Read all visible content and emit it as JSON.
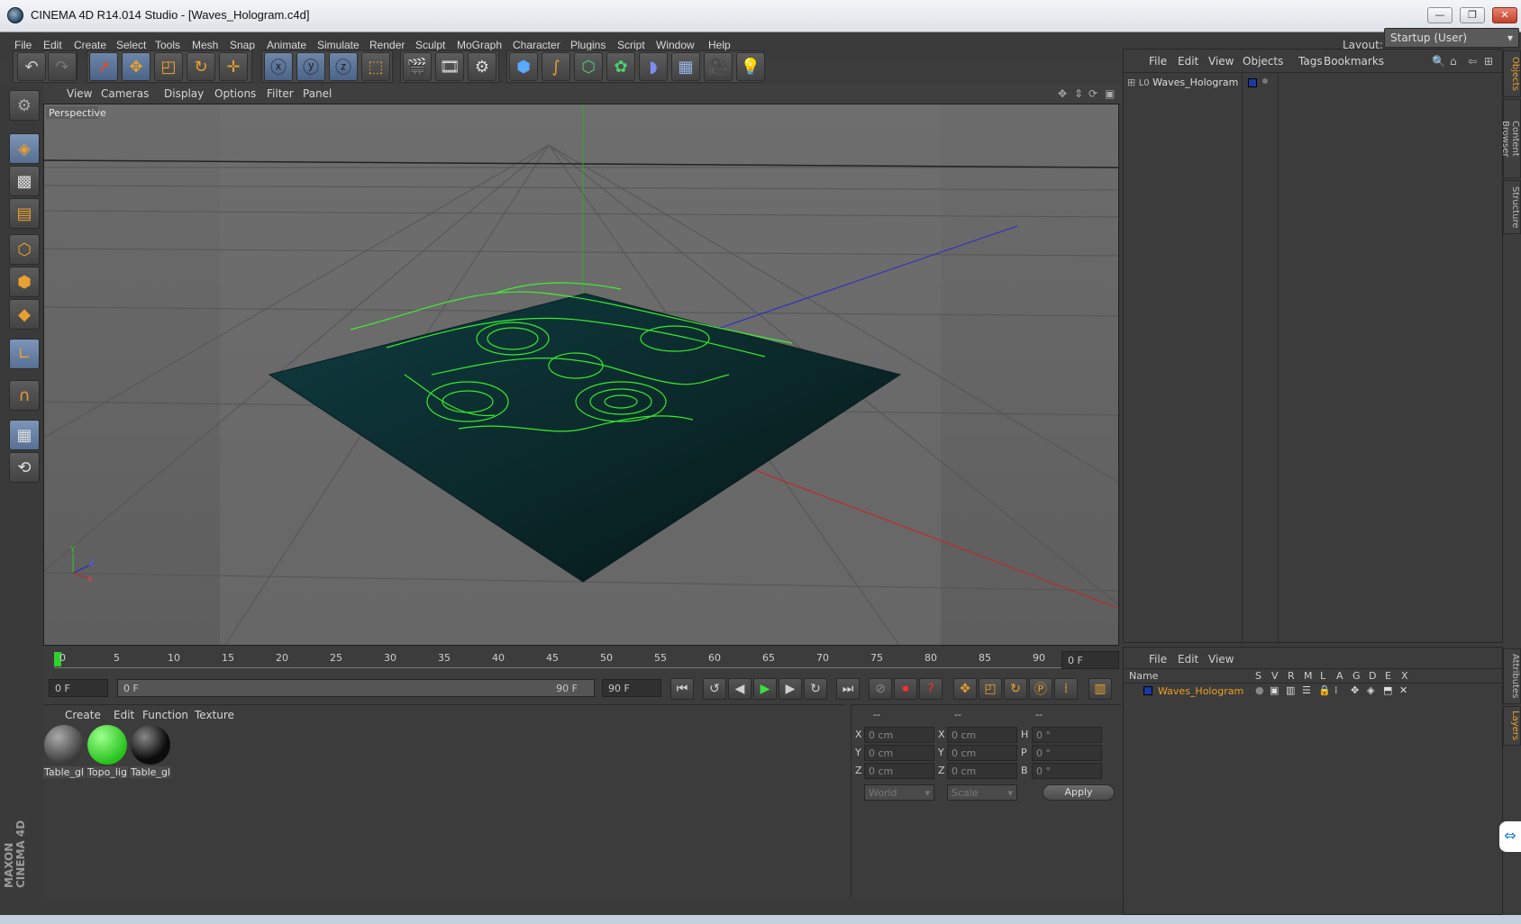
{
  "window": {
    "title": "CINEMA 4D R14.014 Studio - [Waves_Hologram.c4d]",
    "min": "—",
    "max": "❐",
    "close": "✕"
  },
  "menubar": [
    "File",
    "Edit",
    "Create",
    "Select",
    "Tools",
    "Mesh",
    "Snap",
    "Animate",
    "Simulate",
    "Render",
    "Sculpt",
    "MoGraph",
    "Character",
    "Plugins",
    "Script",
    "Window",
    "Help"
  ],
  "layout": {
    "label": "Layout:",
    "value": "Startup (User)"
  },
  "viewport": {
    "menu": [
      "View",
      "Cameras",
      "Display",
      "Options",
      "Filter",
      "Panel"
    ],
    "camera_label": "Perspective",
    "axes": {
      "y": "Y",
      "x": "X",
      "z": "Z"
    }
  },
  "timeline": {
    "ticks": [
      "0",
      "5",
      "10",
      "15",
      "20",
      "25",
      "30",
      "35",
      "40",
      "45",
      "50",
      "55",
      "60",
      "65",
      "70",
      "75",
      "80",
      "85",
      "90"
    ],
    "current_frame": "0 F",
    "start_field": "0 F",
    "range_start": "0 F",
    "range_end": "90 F",
    "end_field": "90 F"
  },
  "materials": {
    "menu": [
      "Create",
      "Edit",
      "Function",
      "Texture"
    ],
    "items": [
      {
        "name": "Table_gl",
        "color": "#5a5a5a"
      },
      {
        "name": "Topo_lig",
        "color": "#36e02a"
      },
      {
        "name": "Table_gl",
        "color": "#1a1a1a"
      }
    ]
  },
  "coordinates": {
    "headers": [
      "--",
      "--",
      "--"
    ],
    "rows": [
      {
        "pos_label": "X",
        "pos": "0 cm",
        "size_label": "X",
        "size": "0 cm",
        "rot_label": "H",
        "rot": "0 °"
      },
      {
        "pos_label": "Y",
        "pos": "0 cm",
        "size_label": "Y",
        "size": "0 cm",
        "rot_label": "P",
        "rot": "0 °"
      },
      {
        "pos_label": "Z",
        "pos": "0 cm",
        "size_label": "Z",
        "size": "0 cm",
        "rot_label": "B",
        "rot": "0 °"
      }
    ],
    "mode1": "World",
    "mode2": "Scale",
    "apply": "Apply"
  },
  "objects": {
    "menu": [
      "File",
      "Edit",
      "View",
      "Objects",
      "Tags",
      "Bookmarks"
    ],
    "items": [
      {
        "name": "Waves_Hologram",
        "prefix": "L0"
      }
    ]
  },
  "layers": {
    "menu": [
      "File",
      "Edit",
      "View"
    ],
    "columns": [
      "Name",
      "S",
      "V",
      "R",
      "M",
      "L",
      "A",
      "G",
      "D",
      "E",
      "X"
    ],
    "items": [
      {
        "name": "Waves_Hologram",
        "color": "#1a3aa0"
      }
    ]
  },
  "side_tabs": {
    "top": [
      "Objects",
      "Content Browser",
      "Structure"
    ],
    "bottom": [
      "Attributes",
      "Layers"
    ]
  },
  "logo": {
    "line1": "MAXON",
    "line2": "CINEMA 4D"
  },
  "colors": {
    "accent": "#e8a030",
    "hologram": "#3cff2a",
    "layer_name": "#f0a020"
  }
}
